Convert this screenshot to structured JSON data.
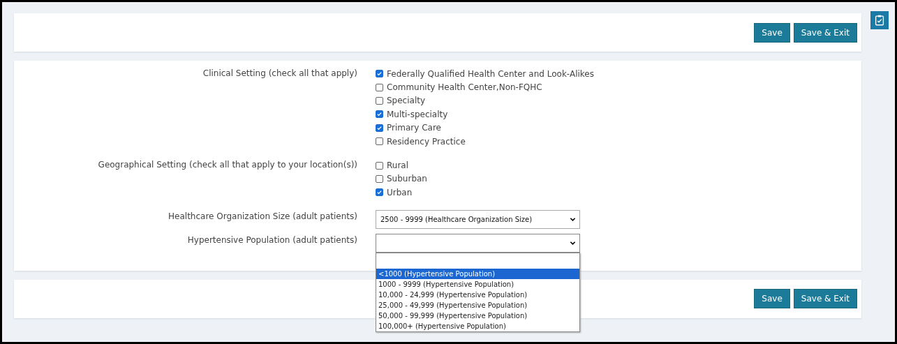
{
  "top_bar": {
    "buttons": [
      "Save",
      "Save & Exit"
    ]
  },
  "form": [
    {
      "kind": "checkbox_group",
      "label": "Clinical Setting (check all that apply)",
      "options": [
        {
          "label": "Federally Qualified Health Center and Look-Alikes",
          "checked": true
        },
        {
          "label": "Community Health Center,Non-FQHC",
          "checked": false
        },
        {
          "label": "Specialty",
          "checked": false
        },
        {
          "label": "Multi-specialty",
          "checked": true
        },
        {
          "label": "Primary Care",
          "checked": true
        },
        {
          "label": "Residency Practice",
          "checked": false
        }
      ]
    },
    {
      "kind": "checkbox_group",
      "label": "Geographical Setting (check all that apply to your location(s))",
      "options": [
        {
          "label": "Rural",
          "checked": false
        },
        {
          "label": "Suburban",
          "checked": false
        },
        {
          "label": "Urban",
          "checked": true
        }
      ]
    },
    {
      "kind": "select",
      "label": "Healthcare Organization Size (adult patients)",
      "value": "2500 - 9999 (Healthcare Organization Size)",
      "expanded": false
    },
    {
      "kind": "select",
      "label": "Hypertensive Population (adult patients)",
      "expanded": true,
      "options": [
        {
          "selected": false
        },
        {
          "label": "<1000 (Hypertensive Population)",
          "selected": true
        },
        {
          "label": "1000 - 9999 (Hypertensive Population)",
          "selected": false
        },
        {
          "label": "10,000 - 24,999 (Hypertensive Population)",
          "selected": false
        },
        {
          "label": "25,000 - 49,999 (Hypertensive Population)",
          "selected": false
        },
        {
          "label": "50,000 - 99,999 (Hypertensive Population)",
          "selected": false
        },
        {
          "label": "100,000+ (Hypertensive Population)",
          "selected": false
        }
      ]
    }
  ],
  "bottom_bar": {
    "buttons": [
      "Save",
      "Save & Exit"
    ]
  }
}
